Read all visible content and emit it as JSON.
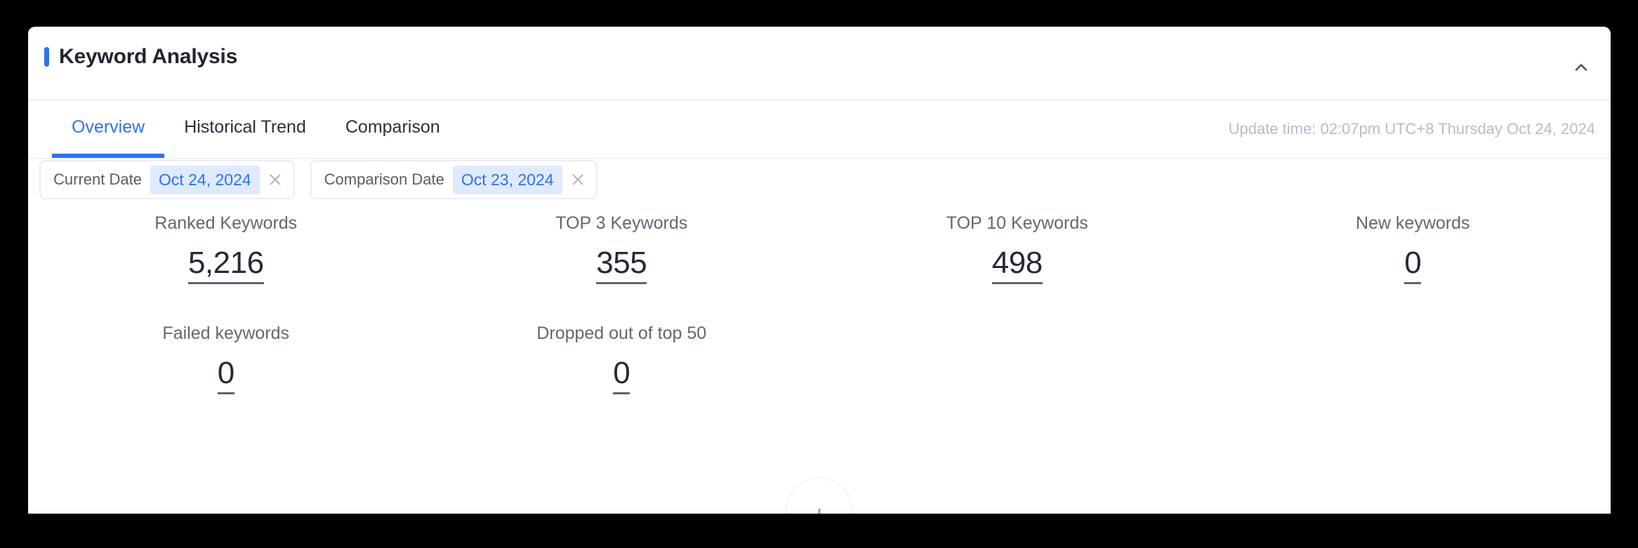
{
  "card": {
    "title": "Keyword Analysis",
    "accent_color": "#2f70f4",
    "collapse_icon": "chevron-up-icon"
  },
  "tabs": [
    {
      "label": "Overview",
      "active": true
    },
    {
      "label": "Historical Trend",
      "active": false
    },
    {
      "label": "Comparison",
      "active": false
    }
  ],
  "update_time": "Update time: 02:07pm UTC+8 Thursday Oct 24, 2024",
  "filters": [
    {
      "label": "Current Date",
      "value": "Oct 24, 2024",
      "close_icon": "close-icon"
    },
    {
      "label": "Comparison Date",
      "value": "Oct 23, 2024",
      "close_icon": "close-icon"
    }
  ],
  "metrics": {
    "row1": [
      {
        "label": "Ranked Keywords",
        "value": "5,216"
      },
      {
        "label": "TOP 3 Keywords",
        "value": "355"
      },
      {
        "label": "TOP 10 Keywords",
        "value": "498"
      },
      {
        "label": "New keywords",
        "value": "0"
      }
    ],
    "row2": [
      {
        "label": "Failed keywords",
        "value": "0"
      },
      {
        "label": "Dropped out of top 50",
        "value": "0"
      }
    ]
  },
  "colors": {
    "accent": "#2f70f4",
    "chip_value_bg": "#dfeaff",
    "text_primary": "#21262f",
    "text_muted": "#606774",
    "text_faint": "#b6bcc8"
  }
}
